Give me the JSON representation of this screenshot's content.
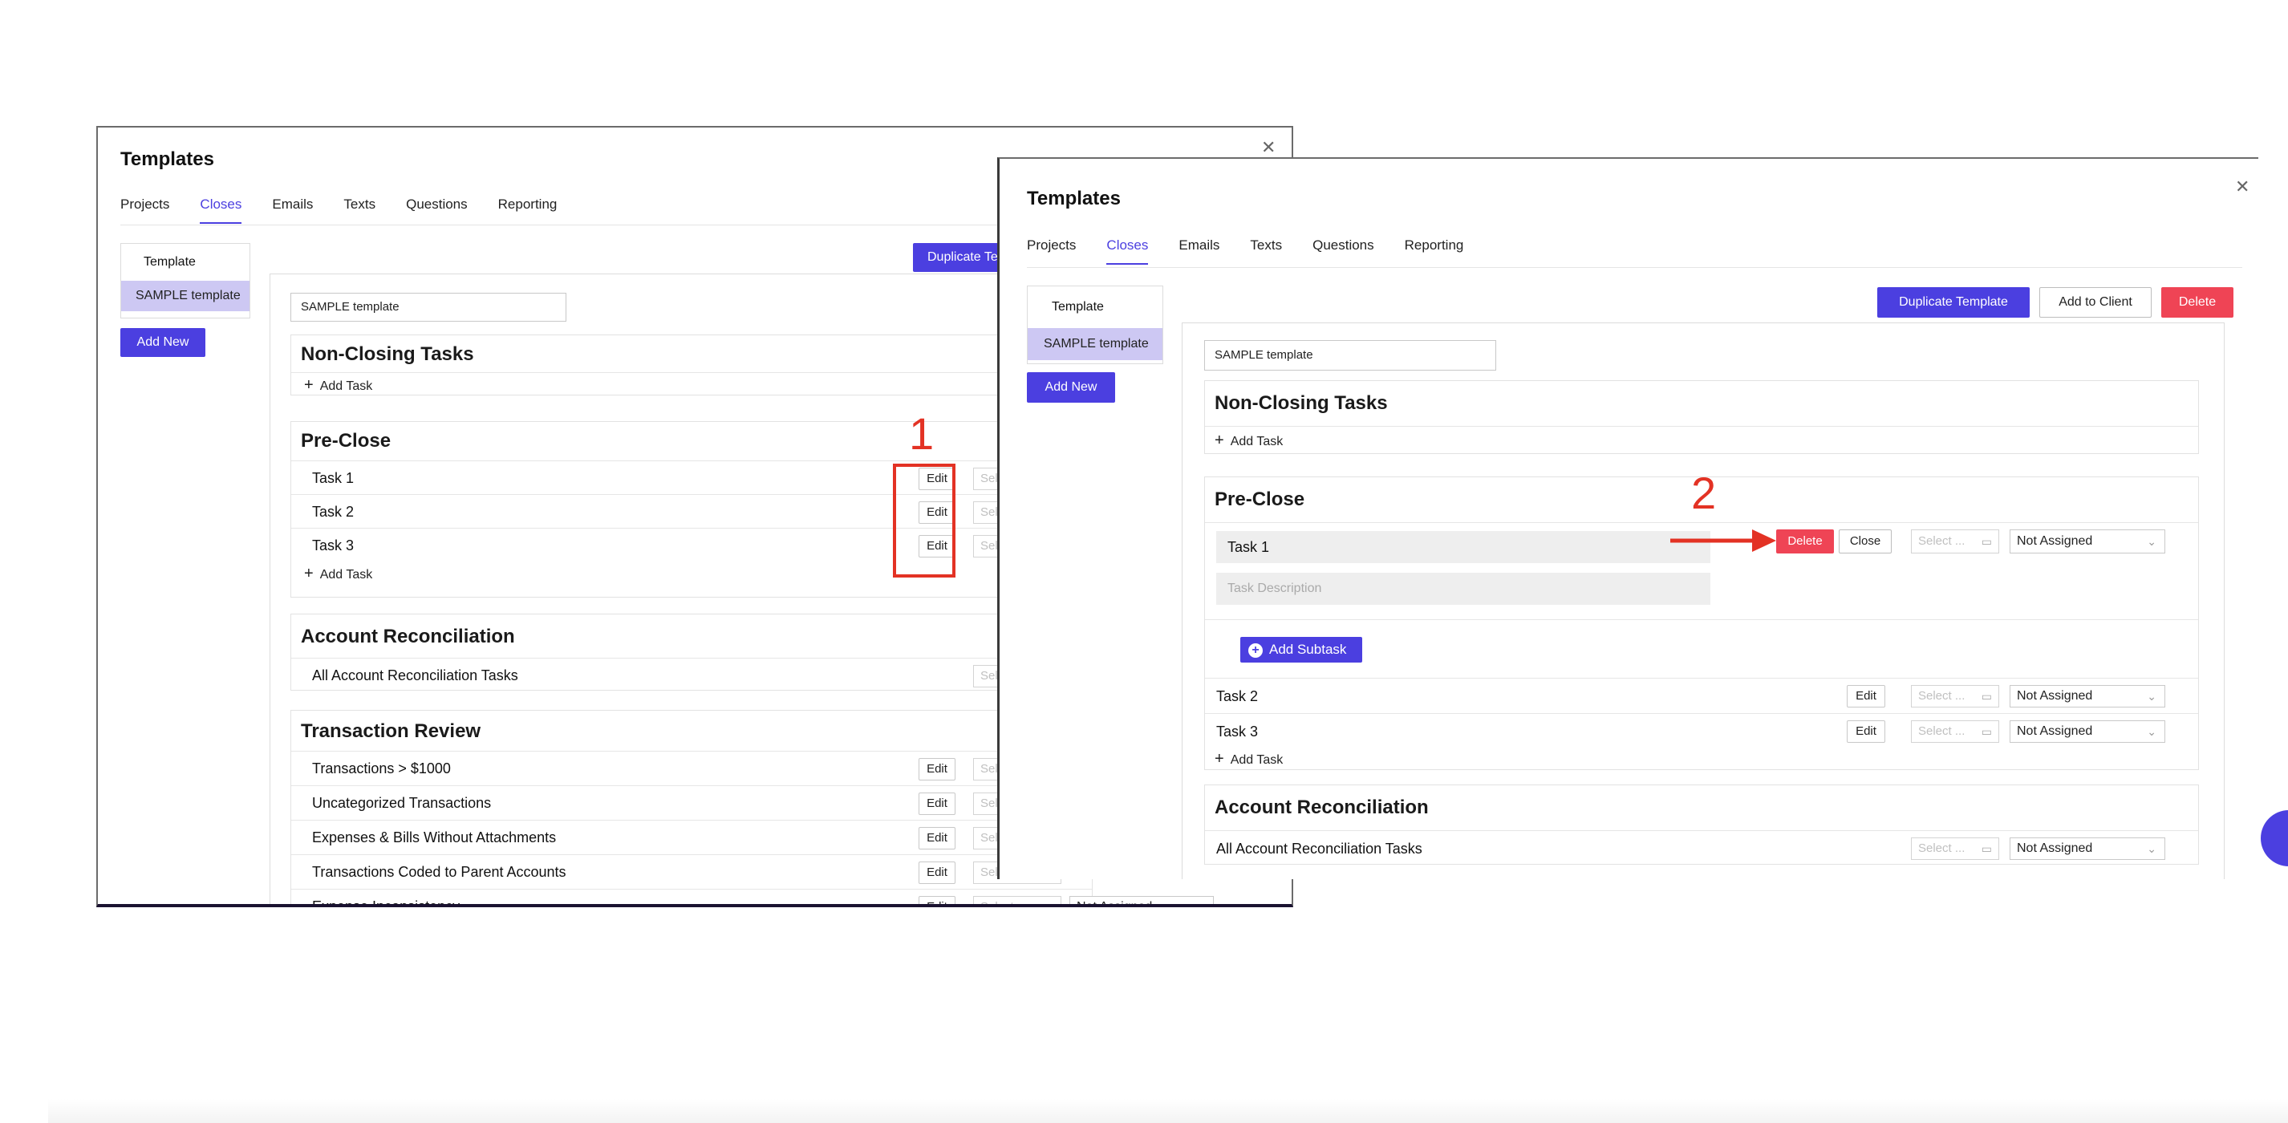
{
  "left": {
    "title": "Templates",
    "tabs": [
      "Projects",
      "Closes",
      "Emails",
      "Texts",
      "Questions",
      "Reporting"
    ],
    "sidebar": {
      "heading": "Template",
      "item": "SAMPLE template",
      "add_new": "Add New"
    },
    "duplicate_label": "Duplicate Te",
    "template_name": "SAMPLE template",
    "non_closing": {
      "title": "Non-Closing Tasks",
      "add_task": "Add Task"
    },
    "pre_close": {
      "title": "Pre-Close",
      "tasks": [
        "Task 1",
        "Task 2",
        "Task 3"
      ],
      "add_task": "Add Task",
      "edit": "Edit",
      "select": "Select"
    },
    "account_rec": {
      "title": "Account Reconciliation",
      "row": "All Account Reconciliation Tasks",
      "select": "Select"
    },
    "transaction_review": {
      "title": "Transaction Review",
      "rows": [
        "Transactions > $1000",
        "Uncategorized Transactions",
        "Expenses & Bills Without Attachments",
        "Transactions Coded to Parent Accounts",
        "Expense Inconsistency"
      ],
      "edit": "Edit",
      "select": "Select",
      "last_assign": "Not Assigned"
    }
  },
  "right": {
    "title": "Templates",
    "tabs": [
      "Projects",
      "Closes",
      "Emails",
      "Texts",
      "Questions",
      "Reporting"
    ],
    "sidebar": {
      "heading": "Template",
      "item": "SAMPLE template",
      "add_new": "Add New"
    },
    "buttons": {
      "duplicate": "Duplicate Template",
      "add_to_client": "Add to Client",
      "delete": "Delete"
    },
    "template_name": "SAMPLE template",
    "non_closing": {
      "title": "Non-Closing Tasks",
      "add_task": "Add Task"
    },
    "pre_close": {
      "title": "Pre-Close",
      "editing_task": {
        "name": "Task 1",
        "description_placeholder": "Task Description",
        "delete": "Delete",
        "close": "Close",
        "select": "Select ...",
        "assign": "Not Assigned",
        "add_subtask": "Add Subtask"
      },
      "tasks": [
        {
          "name": "Task 2",
          "edit": "Edit",
          "select": "Select ...",
          "assign": "Not Assigned"
        },
        {
          "name": "Task 3",
          "edit": "Edit",
          "select": "Select ...",
          "assign": "Not Assigned"
        }
      ],
      "add_task": "Add Task"
    },
    "account_rec": {
      "title": "Account Reconciliation",
      "row": "All Account Reconciliation Tasks",
      "select": "Select ...",
      "assign": "Not Assigned"
    }
  },
  "annotations": {
    "step1": "1",
    "step2": "2"
  },
  "colors": {
    "accent": "#4b3fe0",
    "danger": "#ef4455",
    "annotation": "#e33224",
    "selected_item": "#cdc8f3"
  }
}
